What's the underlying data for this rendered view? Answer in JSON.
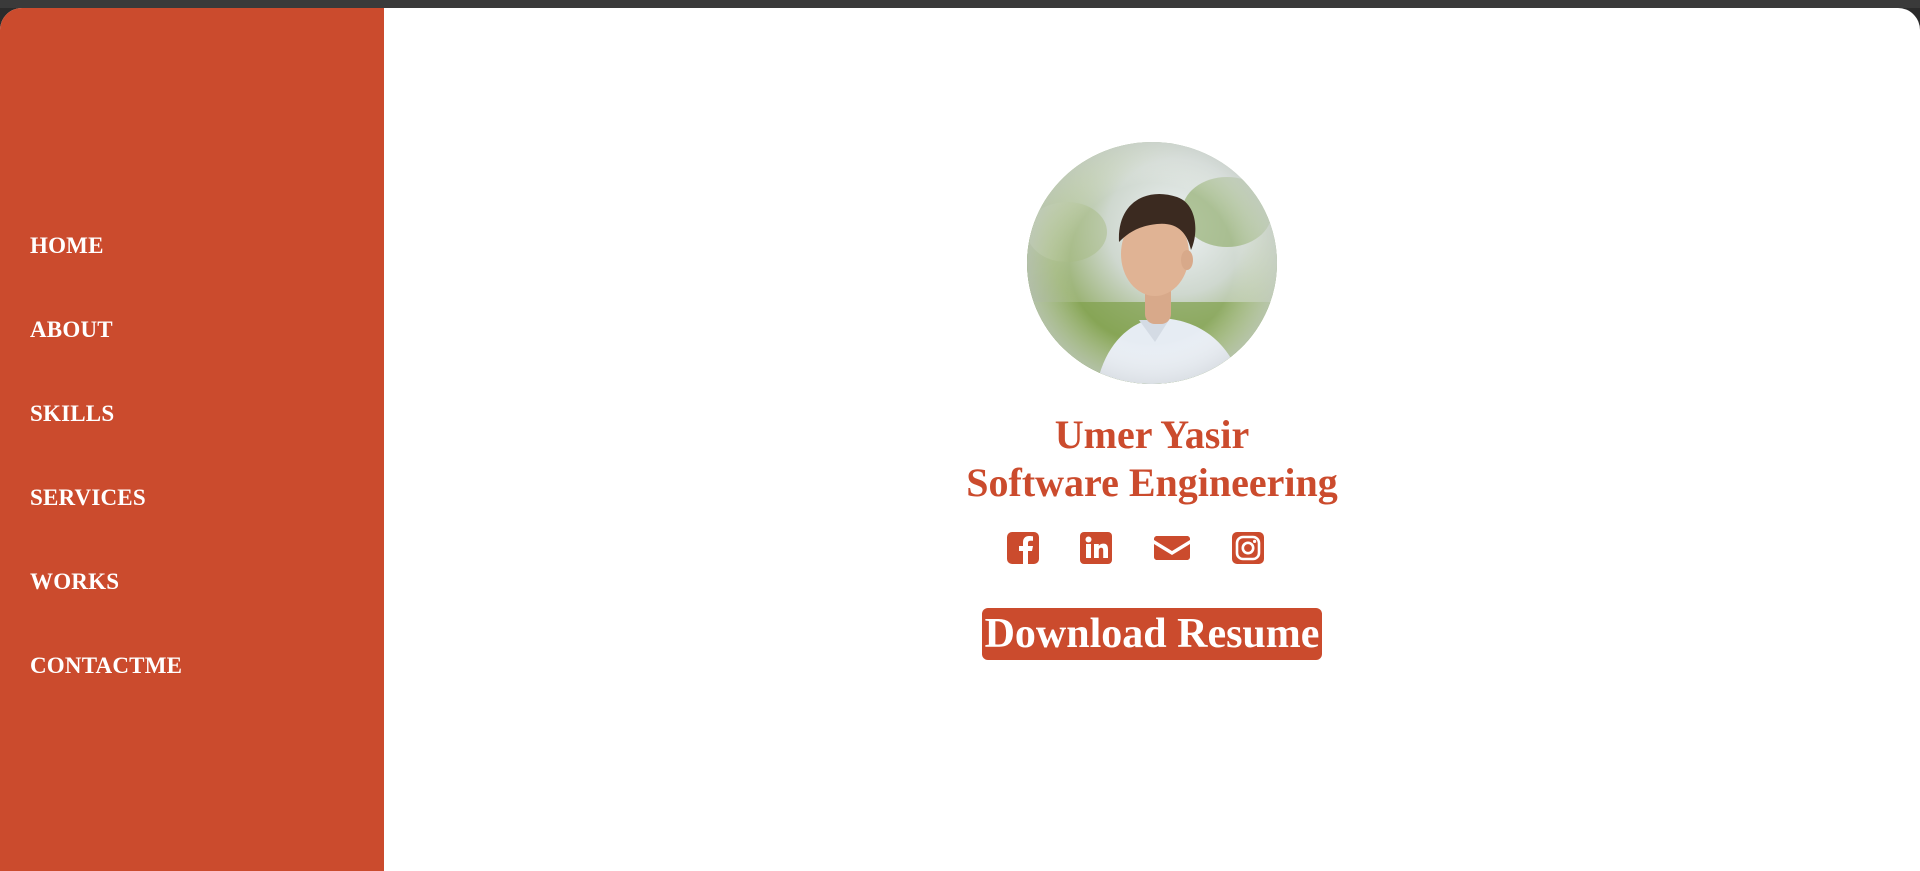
{
  "sidebar": {
    "items": [
      {
        "label": "HOME"
      },
      {
        "label": "ABOUT"
      },
      {
        "label": "SKILLS"
      },
      {
        "label": "SERVICES"
      },
      {
        "label": "WORKS"
      },
      {
        "label": "CONTACTME"
      }
    ]
  },
  "profile": {
    "name": "Umer Yasir",
    "role": "Software Engineering"
  },
  "socials": [
    {
      "icon": "facebook-icon"
    },
    {
      "icon": "linkedin-icon"
    },
    {
      "icon": "mail-icon"
    },
    {
      "icon": "instagram-icon"
    }
  ],
  "cta": {
    "download_label": "Download Resume"
  },
  "colors": {
    "accent": "#cb4b2d",
    "background": "#ffffff",
    "sidebar_text": "#ffffff"
  }
}
